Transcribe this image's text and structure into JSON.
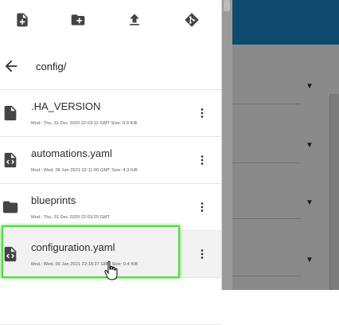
{
  "toolbar": {
    "icons": [
      "new-file-icon",
      "new-folder-icon",
      "upload-icon",
      "git-icon"
    ]
  },
  "path": {
    "current": "config/"
  },
  "files": [
    {
      "name": ".HA_VERSION",
      "meta": "Mod.: Thu, 31 Dec 2020 22:03:12 GMT  Size: 0.0 KiB",
      "icon": "file-icon"
    },
    {
      "name": "automations.yaml",
      "meta": "Mod.: Wed, 06 Jan 2021 02:11:00 GMT  Size: 4.3 KiB",
      "icon": "code-file-icon"
    },
    {
      "name": "blueprints",
      "meta": "Mod.: Thu, 31 Dec 2020 22:03:20 GMT",
      "icon": "folder-icon"
    },
    {
      "name": "configuration.yaml",
      "meta": "Mod.: Wed, 06 Jan 2021 22:18:37 GMT  Size: 0.4 KiB",
      "icon": "code-file-icon"
    }
  ],
  "colors": {
    "highlight": "#4fdc3d",
    "header": "#0e4a6e",
    "icon": "#444444"
  }
}
